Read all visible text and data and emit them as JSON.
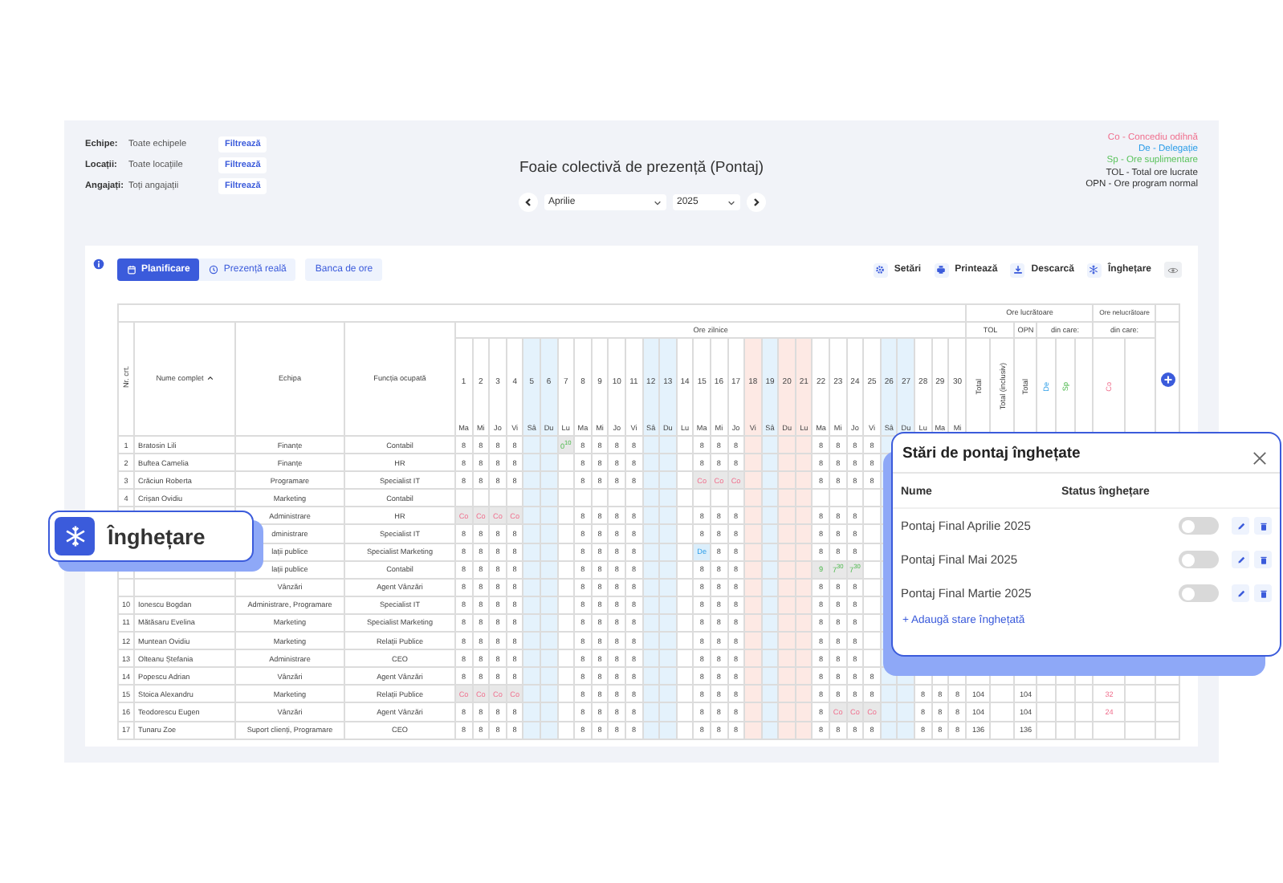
{
  "filters": [
    {
      "label": "Echipe:",
      "value": "Toate echipele",
      "button": "Filtrează"
    },
    {
      "label": "Locații:",
      "value": "Toate locațiile",
      "button": "Filtrează"
    },
    {
      "label": "Angajați:",
      "value": "Toți angajații",
      "button": "Filtrează"
    }
  ],
  "title": "Foaie colectivă de prezență (Pontaj)",
  "period": {
    "month": "Aprilie",
    "year": "2025"
  },
  "legend": [
    {
      "text": "Co - Concediu odihnă",
      "color": "#f0708e"
    },
    {
      "text": "De - Delegație",
      "color": "#2b9de8"
    },
    {
      "text": "Sp - Ore suplimentare",
      "color": "#5cc35e"
    },
    {
      "text": "TOL - Total ore lucrate",
      "color": "#333333"
    },
    {
      "text": "OPN - Ore program normal",
      "color": "#333333"
    }
  ],
  "toolbar": {
    "tabs": [
      {
        "label": "Planificare",
        "selected": true,
        "kind": "calendar"
      },
      {
        "label": "Prezență reală",
        "selected": false,
        "kind": "clock"
      }
    ],
    "extra_button": "Banca de ore",
    "actions": [
      {
        "label": "Setări",
        "kind": "gear"
      },
      {
        "label": "Printează",
        "kind": "printer"
      },
      {
        "label": "Descarcă",
        "kind": "download"
      },
      {
        "label": "Înghețare",
        "kind": "snowflake"
      }
    ]
  },
  "table": {
    "group_headers": [
      "Ore lucrătoare",
      "Ore nelucrătoare"
    ],
    "daily_header": "Ore zilnice",
    "sub_headers": [
      "TOL",
      "OPN",
      "din care:",
      "din care:"
    ],
    "columns": [
      "Nr. crt.",
      "Nume complet",
      "Echipa",
      "Funcția ocupată"
    ],
    "days": [
      {
        "num": "1",
        "dow": "Ma",
        "kind": "work"
      },
      {
        "num": "2",
        "dow": "Mi",
        "kind": "work"
      },
      {
        "num": "3",
        "dow": "Jo",
        "kind": "work"
      },
      {
        "num": "4",
        "dow": "Vi",
        "kind": "work"
      },
      {
        "num": "5",
        "dow": "Sâ",
        "kind": "weekend"
      },
      {
        "num": "6",
        "dow": "Du",
        "kind": "weekend"
      },
      {
        "num": "7",
        "dow": "Lu",
        "kind": "work"
      },
      {
        "num": "8",
        "dow": "Ma",
        "kind": "work"
      },
      {
        "num": "9",
        "dow": "Mi",
        "kind": "work"
      },
      {
        "num": "10",
        "dow": "Jo",
        "kind": "work"
      },
      {
        "num": "11",
        "dow": "Vi",
        "kind": "work"
      },
      {
        "num": "12",
        "dow": "Sâ",
        "kind": "weekend"
      },
      {
        "num": "13",
        "dow": "Du",
        "kind": "weekend"
      },
      {
        "num": "14",
        "dow": "Lu",
        "kind": "work"
      },
      {
        "num": "15",
        "dow": "Ma",
        "kind": "work"
      },
      {
        "num": "16",
        "dow": "Mi",
        "kind": "work"
      },
      {
        "num": "17",
        "dow": "Jo",
        "kind": "work"
      },
      {
        "num": "18",
        "dow": "Vi",
        "kind": "holiday"
      },
      {
        "num": "19",
        "dow": "Sâ",
        "kind": "weekend"
      },
      {
        "num": "20",
        "dow": "Du",
        "kind": "holiday"
      },
      {
        "num": "21",
        "dow": "Lu",
        "kind": "holiday"
      },
      {
        "num": "22",
        "dow": "Ma",
        "kind": "work"
      },
      {
        "num": "23",
        "dow": "Mi",
        "kind": "work"
      },
      {
        "num": "24",
        "dow": "Jo",
        "kind": "work"
      },
      {
        "num": "25",
        "dow": "Vi",
        "kind": "work"
      },
      {
        "num": "26",
        "dow": "Sâ",
        "kind": "weekend"
      },
      {
        "num": "27",
        "dow": "Du",
        "kind": "weekend"
      },
      {
        "num": "28",
        "dow": "Lu",
        "kind": "work"
      },
      {
        "num": "29",
        "dow": "Ma",
        "kind": "work"
      },
      {
        "num": "30",
        "dow": "Mi",
        "kind": "work"
      }
    ],
    "summary_columns": [
      {
        "label": "Total",
        "kind": "plain"
      },
      {
        "label": "Total (inclusiv)",
        "kind": "plain"
      },
      {
        "label": "Total",
        "kind": "plain"
      },
      {
        "label": "De",
        "kind": "delegation"
      },
      {
        "label": "Sp",
        "kind": "overtime"
      },
      {
        "kind": "blank"
      },
      {
        "label": "Co",
        "kind": "leave"
      },
      {
        "kind": "blank"
      }
    ],
    "rows": [
      {
        "nr": "1",
        "name": "Bratosin Lili",
        "team": "Finanțe",
        "role": "Contabil",
        "hours": {
          "1": "8",
          "2": "8",
          "3": "8",
          "4": "8",
          "7": {
            "text": "0$^{10}$",
            "kind": "overtime"
          },
          "8": "8",
          "9": "8",
          "10": "8",
          "11": "8",
          "15": "8",
          "16": "8",
          "17": "8",
          "22": "8",
          "23": "8",
          "24": "8",
          "25": "8"
        }
      },
      {
        "nr": "2",
        "name": "Buftea Camelia",
        "team": "Finanțe",
        "role": "HR",
        "hours": {
          "1": "8",
          "2": "8",
          "3": "8",
          "4": "8",
          "8": "8",
          "9": "8",
          "10": "8",
          "11": "8",
          "15": "8",
          "16": "8",
          "17": "8",
          "22": "8",
          "23": "8",
          "24": "8",
          "25": "8"
        }
      },
      {
        "nr": "3",
        "name": "Crăciun Roberta",
        "team": "Programare",
        "role": "Specialist IT",
        "hours": {
          "1": "8",
          "2": "8",
          "3": "8",
          "4": "8",
          "8": "8",
          "9": "8",
          "10": "8",
          "11": "8",
          "15": {
            "text": "Co",
            "kind": "leave"
          },
          "16": {
            "text": "Co",
            "kind": "leave"
          },
          "17": {
            "text": "Co",
            "kind": "leave"
          },
          "22": "8",
          "23": "8",
          "24": "8",
          "25": "8"
        }
      },
      {
        "nr": "4",
        "name": "Crișan Ovidiu",
        "team": "Marketing",
        "role": "Contabil"
      },
      {
        "team": "Administrare",
        "role": "HR",
        "hours": {
          "1": {
            "text": "Co",
            "kind": "leave"
          },
          "2": {
            "text": "Co",
            "kind": "leave"
          },
          "3": {
            "text": "Co",
            "kind": "leave"
          },
          "4": {
            "text": "Co",
            "kind": "leave"
          },
          "8": "8",
          "9": "8",
          "10": "8",
          "11": "8",
          "15": "8",
          "16": "8",
          "17": "8",
          "22": "8",
          "23": "8",
          "24": "8"
        }
      },
      {
        "team": "dministrare",
        "role": "Specialist IT",
        "hours": {
          "1": "8",
          "2": "8",
          "3": "8",
          "4": "8",
          "8": "8",
          "9": "8",
          "10": "8",
          "11": "8",
          "15": "8",
          "16": "8",
          "17": "8",
          "22": "8",
          "23": "8",
          "24": "8"
        }
      },
      {
        "team": "lații publice",
        "role": "Specialist Marketing",
        "hours": {
          "1": "8",
          "2": "8",
          "3": "8",
          "4": "8",
          "8": "8",
          "9": "8",
          "10": "8",
          "11": "8",
          "15": {
            "text": "De",
            "kind": "delegation"
          },
          "16": "8",
          "17": "8",
          "22": "8",
          "23": "8",
          "24": "8"
        }
      },
      {
        "team": "lații publice",
        "role": "Contabil",
        "hours": {
          "1": "8",
          "2": "8",
          "3": "8",
          "4": "8",
          "8": "8",
          "9": "8",
          "10": "8",
          "11": "8",
          "15": "8",
          "16": "8",
          "17": "8",
          "22": {
            "text": "9",
            "kind": "overtime"
          },
          "23": {
            "text": "7$^{30}$",
            "kind": "overtime"
          },
          "24": {
            "text": "7$^{30}$",
            "kind": "overtime"
          }
        }
      },
      {
        "team": "Vânzări",
        "role": "Agent Vânzări",
        "hours": {
          "1": "8",
          "2": "8",
          "3": "8",
          "4": "8",
          "8": "8",
          "9": "8",
          "10": "8",
          "11": "8",
          "15": "8",
          "16": "8",
          "17": "8",
          "22": "8",
          "23": "8",
          "24": "8"
        }
      },
      {
        "nr": "10",
        "name": "Ionescu Bogdan",
        "team": "Administrare, Programare",
        "role": "Specialist IT",
        "hours": {
          "1": "8",
          "2": "8",
          "3": "8",
          "4": "8",
          "8": "8",
          "9": "8",
          "10": "8",
          "11": "8",
          "15": "8",
          "16": "8",
          "17": "8",
          "22": "8",
          "23": "8",
          "24": "8"
        }
      },
      {
        "nr": "11",
        "name": "Mătăsaru Evelina",
        "team": "Marketing",
        "role": "Specialist Marketing",
        "hours": {
          "1": "8",
          "2": "8",
          "3": "8",
          "4": "8",
          "8": "8",
          "9": "8",
          "10": "8",
          "11": "8",
          "15": "8",
          "16": "8",
          "17": "8",
          "22": "8",
          "23": "8",
          "24": "8"
        }
      },
      {
        "nr": "12",
        "name": "Muntean Ovidiu",
        "team": "Marketing",
        "role": "Relații Publice",
        "hours": {
          "1": "8",
          "2": "8",
          "3": "8",
          "4": "8",
          "8": "8",
          "9": "8",
          "10": "8",
          "11": "8",
          "15": "8",
          "16": "8",
          "17": "8",
          "22": "8",
          "23": "8",
          "24": "8"
        }
      },
      {
        "nr": "13",
        "name": "Olteanu Ștefania",
        "team": "Administrare",
        "role": "CEO",
        "hours": {
          "1": "8",
          "2": "8",
          "3": "8",
          "4": "8",
          "8": "8",
          "9": "8",
          "10": "8",
          "11": "8",
          "15": "8",
          "16": "8",
          "17": "8",
          "22": "8",
          "23": "8",
          "24": "8"
        }
      },
      {
        "nr": "14",
        "name": "Popescu Adrian",
        "team": "Vânzări",
        "role": "Agent Vânzări",
        "hours": {
          "1": "8",
          "2": "8",
          "3": "8",
          "4": "8",
          "8": "8",
          "9": "8",
          "10": "8",
          "11": "8",
          "15": "8",
          "16": "8",
          "17": "8",
          "22": "8",
          "23": "8",
          "24": "8",
          "25": "8"
        }
      },
      {
        "nr": "15",
        "name": "Stoica Alexandru",
        "team": "Marketing",
        "role": "Relații Publice",
        "hours": {
          "1": {
            "text": "Co",
            "kind": "leave"
          },
          "2": {
            "text": "Co",
            "kind": "leave"
          },
          "3": {
            "text": "Co",
            "kind": "leave"
          },
          "4": {
            "text": "Co",
            "kind": "leave"
          },
          "8": "8",
          "9": "8",
          "10": "8",
          "11": "8",
          "15": "8",
          "16": "8",
          "17": "8",
          "22": "8",
          "23": "8",
          "24": "8",
          "25": "8",
          "28": "8",
          "29": "8",
          "30": "8"
        },
        "totals": {
          "tol_total": "104",
          "opn_total": "104",
          "co": "32"
        }
      },
      {
        "nr": "16",
        "name": "Teodorescu Eugen",
        "team": "Vânzări",
        "role": "Agent Vânzări",
        "hours": {
          "1": "8",
          "2": "8",
          "3": "8",
          "4": "8",
          "8": "8",
          "9": "8",
          "10": "8",
          "11": "8",
          "15": "8",
          "16": "8",
          "17": "8",
          "22": "8",
          "23": {
            "text": "Co",
            "kind": "leave"
          },
          "24": {
            "text": "Co",
            "kind": "leave"
          },
          "25": {
            "text": "Co",
            "kind": "leave"
          },
          "28": "8",
          "29": "8",
          "30": "8"
        },
        "totals": {
          "tol_total": "104",
          "opn_total": "104",
          "co": "24"
        }
      },
      {
        "nr": "17",
        "name": "Tunaru Zoe",
        "team": "Suport clienți, Programare",
        "role": "CEO",
        "hours": {
          "1": "8",
          "2": "8",
          "3": "8",
          "4": "8",
          "8": "8",
          "9": "8",
          "10": "8",
          "11": "8",
          "15": "8",
          "16": "8",
          "17": "8",
          "22": "8",
          "23": "8",
          "24": "8",
          "25": "8",
          "28": "8",
          "29": "8",
          "30": "8"
        },
        "totals": {
          "tol_total": "136",
          "opn_total": "136"
        }
      }
    ]
  },
  "badge": {
    "label": "Înghețare"
  },
  "dialog": {
    "title": "Stări de pontaj înghețate",
    "headers": [
      "Nume",
      "Status înghețare"
    ],
    "items": [
      {
        "name": "Pontaj Final Aprilie 2025",
        "frozen": false
      },
      {
        "name": "Pontaj Final Mai 2025",
        "frozen": false
      },
      {
        "name": "Pontaj Final Martie 2025",
        "frozen": false
      }
    ],
    "add_link": "+ Adaugă stare înghețată"
  }
}
